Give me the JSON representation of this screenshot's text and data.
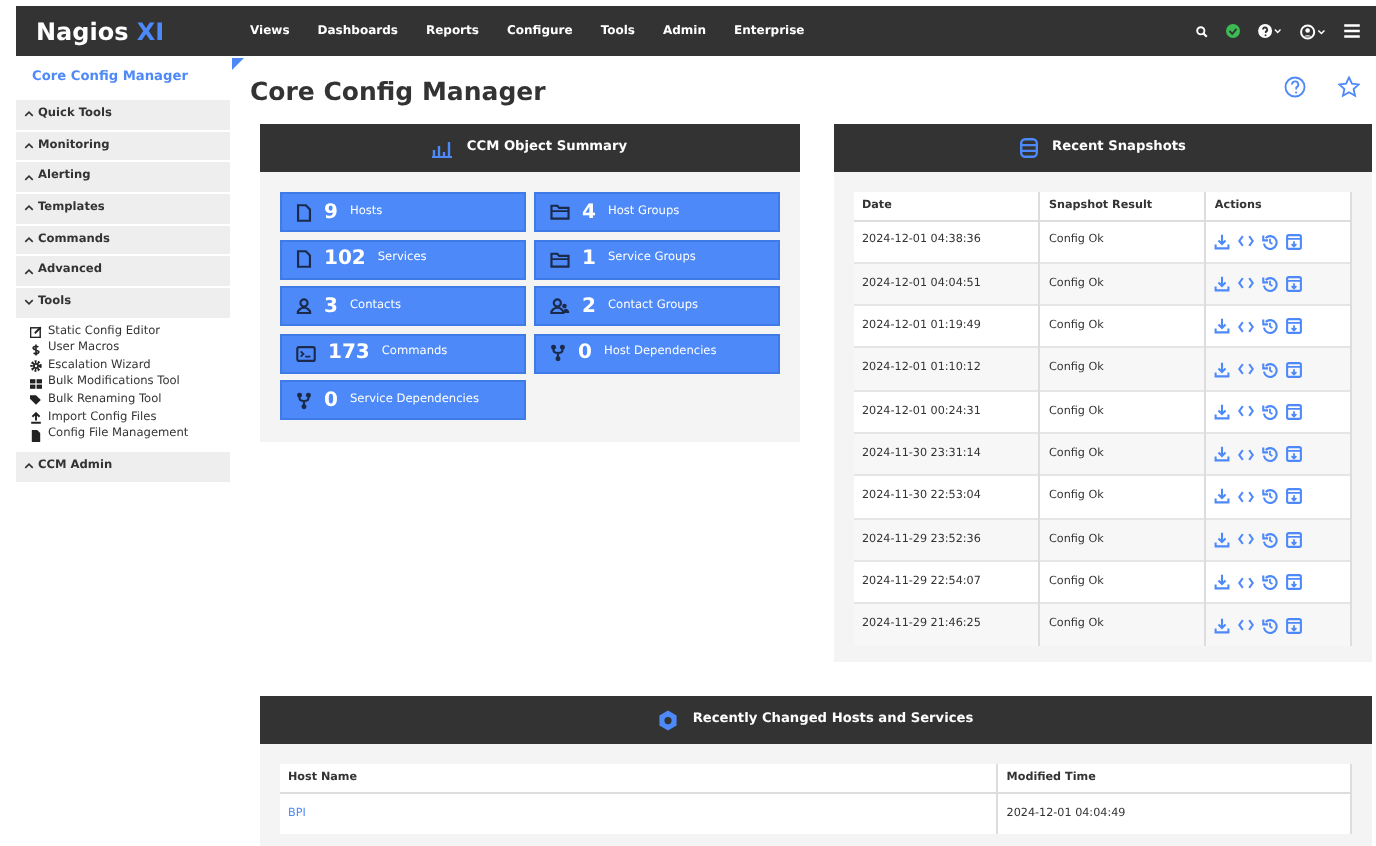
{
  "brand": {
    "name": "Nagios",
    "suffix": "XI"
  },
  "nav": [
    "Views",
    "Dashboards",
    "Reports",
    "Configure",
    "Tools",
    "Admin",
    "Enterprise"
  ],
  "sidebar": {
    "title": "Core Config Manager",
    "sections": [
      {
        "label": "Quick Tools",
        "expanded": false
      },
      {
        "label": "Monitoring",
        "expanded": false
      },
      {
        "label": "Alerting",
        "expanded": false
      },
      {
        "label": "Templates",
        "expanded": false
      },
      {
        "label": "Commands",
        "expanded": false
      },
      {
        "label": "Advanced",
        "expanded": false
      },
      {
        "label": "Tools",
        "expanded": true,
        "items": [
          {
            "kind": "edit",
            "label": "Static Config Editor"
          },
          {
            "kind": "dollar",
            "label": "User Macros"
          },
          {
            "kind": "gear",
            "label": "Escalation Wizard"
          },
          {
            "kind": "grid",
            "label": "Bulk Modifications Tool"
          },
          {
            "kind": "tag",
            "label": "Bulk Renaming Tool"
          },
          {
            "kind": "upload",
            "label": "Import Config Files"
          },
          {
            "kind": "file",
            "label": "Config File Management"
          }
        ]
      },
      {
        "label": "CCM Admin",
        "expanded": false
      }
    ]
  },
  "page_title": "Core Config Manager",
  "summary": {
    "title": "CCM Object Summary",
    "tiles": [
      {
        "kind": "file",
        "count": "9",
        "label": "Hosts"
      },
      {
        "kind": "folder",
        "count": "4",
        "label": "Host Groups"
      },
      {
        "kind": "file",
        "count": "102",
        "label": "Services"
      },
      {
        "kind": "folder",
        "count": "1",
        "label": "Service Groups"
      },
      {
        "kind": "user",
        "count": "3",
        "label": "Contacts"
      },
      {
        "kind": "users",
        "count": "2",
        "label": "Contact Groups"
      },
      {
        "kind": "terminal",
        "count": "173",
        "label": "Commands"
      },
      {
        "kind": "fork",
        "count": "0",
        "label": "Host Dependencies"
      },
      {
        "kind": "fork",
        "count": "0",
        "label": "Service Dependencies"
      }
    ]
  },
  "snapshots": {
    "title": "Recent Snapshots",
    "columns": [
      "Date",
      "Snapshot Result",
      "Actions"
    ],
    "rows": [
      {
        "date": "2024-12-01 04:38:36",
        "result": "Config Ok"
      },
      {
        "date": "2024-12-01 04:04:51",
        "result": "Config Ok"
      },
      {
        "date": "2024-12-01 01:19:49",
        "result": "Config Ok"
      },
      {
        "date": "2024-12-01 01:10:12",
        "result": "Config Ok"
      },
      {
        "date": "2024-12-01 00:24:31",
        "result": "Config Ok"
      },
      {
        "date": "2024-11-30 23:31:14",
        "result": "Config Ok"
      },
      {
        "date": "2024-11-30 22:53:04",
        "result": "Config Ok"
      },
      {
        "date": "2024-11-29 23:52:36",
        "result": "Config Ok"
      },
      {
        "date": "2024-11-29 22:54:07",
        "result": "Config Ok"
      },
      {
        "date": "2024-11-29 21:46:25",
        "result": "Config Ok"
      }
    ]
  },
  "recent": {
    "title": "Recently Changed Hosts and Services",
    "columns": [
      "Host Name",
      "Modified Time"
    ],
    "rows": [
      {
        "host": "BPI",
        "modified": "2024-12-01 04:04:49"
      }
    ]
  }
}
